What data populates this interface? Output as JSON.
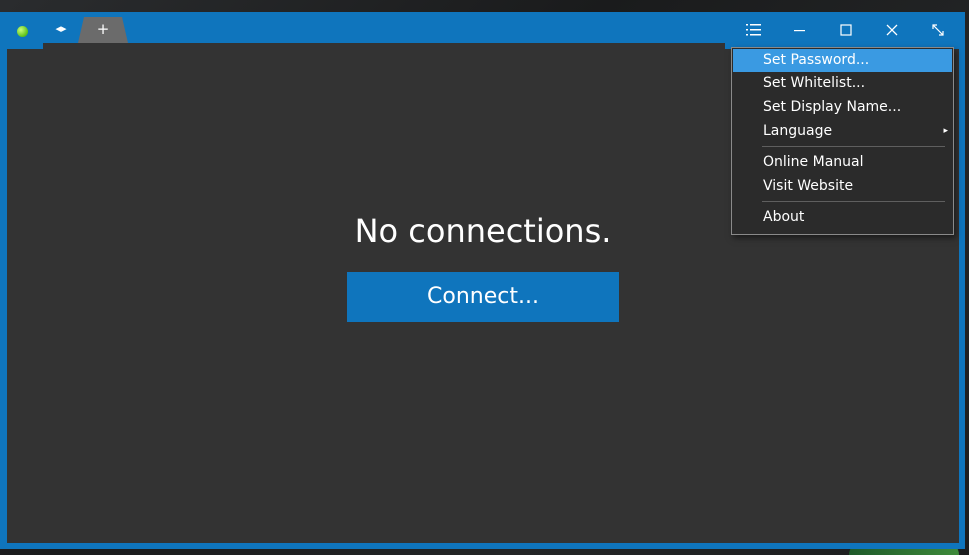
{
  "titlebar": {
    "nav_arrows": "◂▸",
    "add_tab": "+",
    "status_color": "#5bbf1a"
  },
  "main": {
    "empty_message": "No connections.",
    "connect_label": "Connect..."
  },
  "menu": {
    "items": [
      {
        "label": "Set Password...",
        "active": true
      },
      {
        "label": "Set Whitelist..."
      },
      {
        "label": "Set Display Name..."
      },
      {
        "label": "Language",
        "submenu": true
      },
      {
        "label": "Online Manual"
      },
      {
        "label": "Visit Website"
      },
      {
        "label": "About"
      }
    ],
    "submenu_arrow": "▸"
  },
  "icons": [
    "menu-list-icon",
    "minimize-icon",
    "maximize-icon",
    "close-icon",
    "fullscreen-icon"
  ],
  "colors": {
    "accent": "#0f75bd",
    "content_bg": "#333333",
    "menu_highlight": "#3a9ae2"
  }
}
